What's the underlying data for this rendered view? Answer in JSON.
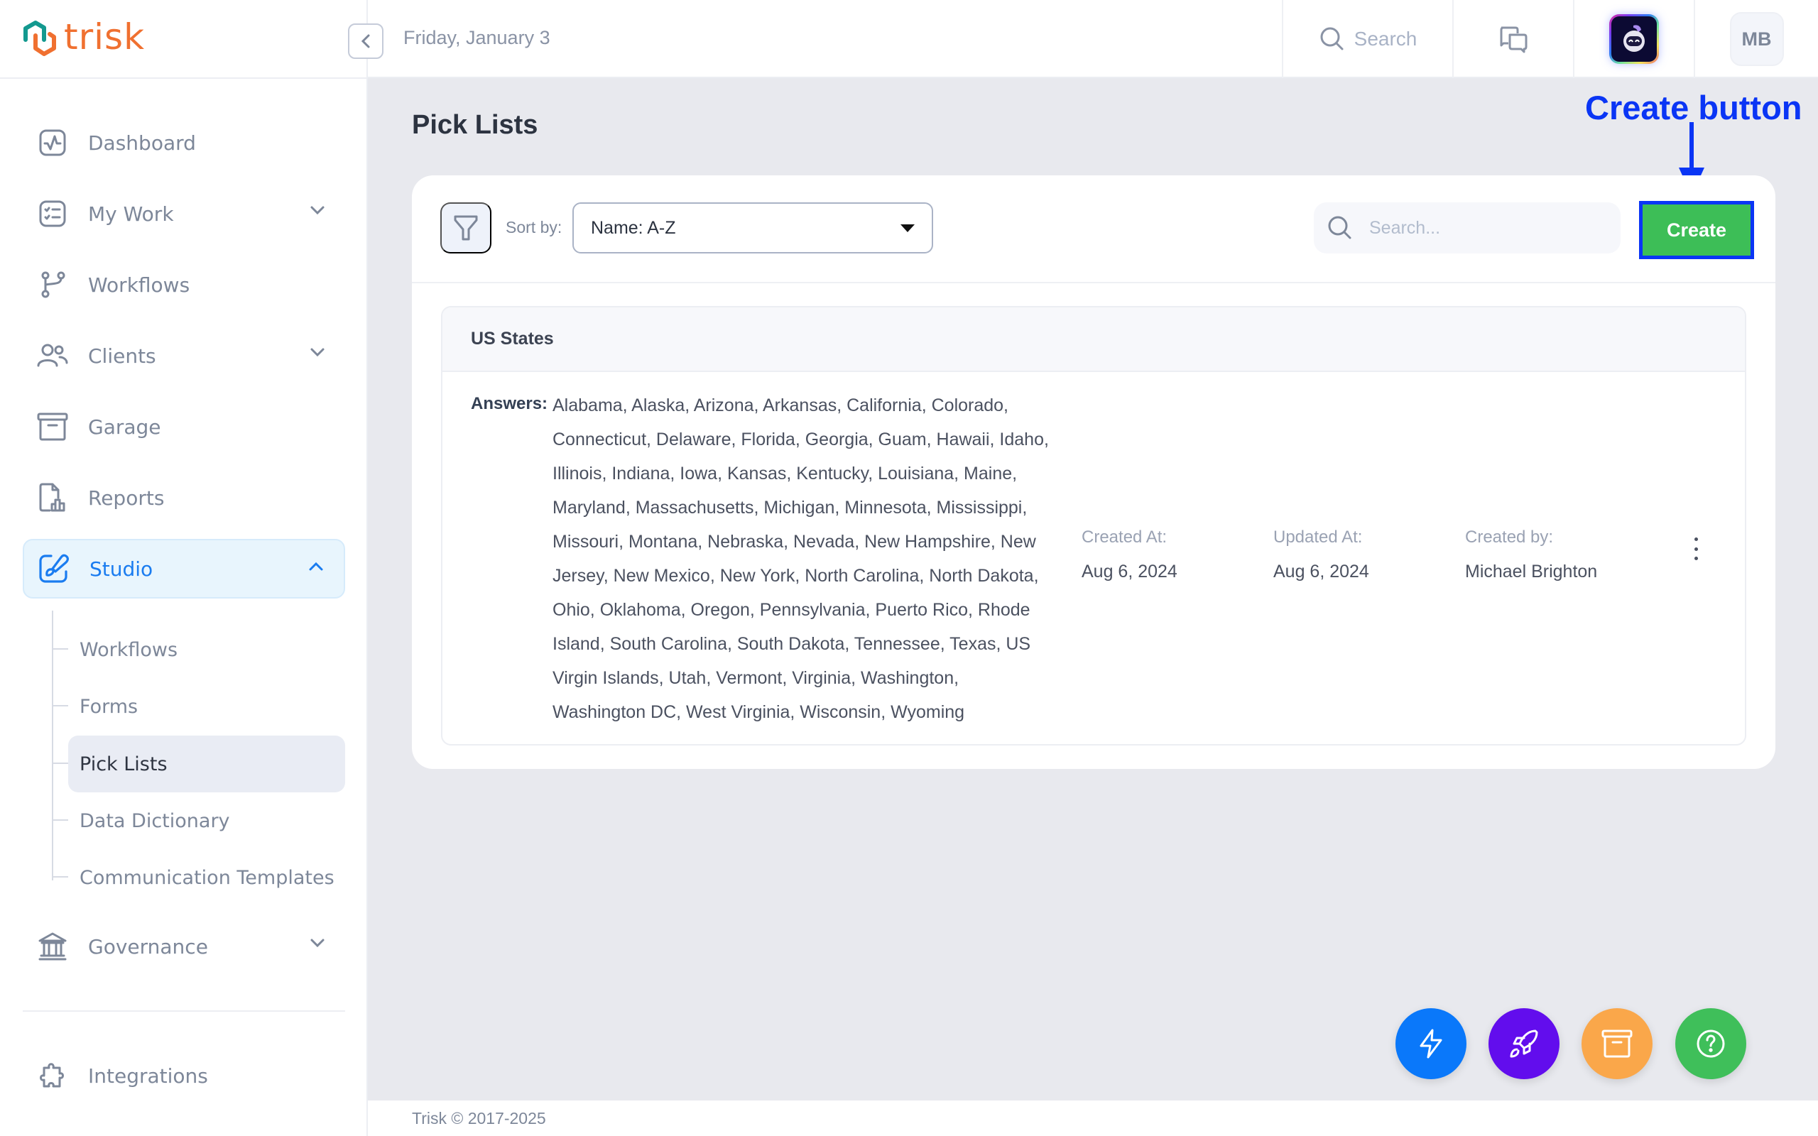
{
  "app": {
    "brand": "trisk",
    "brand_colors": {
      "orange": "#f07030",
      "teal": "#13998f"
    }
  },
  "header": {
    "date": "Friday, January 3",
    "search_label": "Search",
    "user_initials": "MB"
  },
  "sidebar": {
    "items": [
      {
        "label": "Dashboard",
        "icon": "activity-icon",
        "has_chevron": false
      },
      {
        "label": "My Work",
        "icon": "checklist-icon",
        "has_chevron": true
      },
      {
        "label": "Workflows",
        "icon": "git-branch-icon",
        "has_chevron": false
      },
      {
        "label": "Clients",
        "icon": "users-icon",
        "has_chevron": true
      },
      {
        "label": "Garage",
        "icon": "archive-icon",
        "has_chevron": false
      },
      {
        "label": "Reports",
        "icon": "report-chart-icon",
        "has_chevron": false
      },
      {
        "label": "Studio",
        "icon": "brush-icon",
        "has_chevron": true,
        "expanded": true,
        "active": true
      },
      {
        "label": "Governance",
        "icon": "bank-icon",
        "has_chevron": true
      },
      {
        "label": "Integrations",
        "icon": "puzzle-icon",
        "has_chevron": false
      }
    ],
    "studio_subitems": [
      {
        "label": "Workflows"
      },
      {
        "label": "Forms"
      },
      {
        "label": "Pick Lists",
        "active": true
      },
      {
        "label": "Data Dictionary"
      },
      {
        "label": "Communication Templates"
      }
    ]
  },
  "main": {
    "page_title": "Pick Lists",
    "annotation": "Create button",
    "toolbar": {
      "sort_label": "Sort by:",
      "sort_value": "Name: A-Z",
      "search_placeholder": "Search...",
      "create_label": "Create",
      "create_color": "#3dbe57"
    },
    "pick_lists": [
      {
        "title": "US States",
        "answers_label": "Answers:",
        "answers": "Alabama, Alaska, Arizona, Arkansas, California, Colorado, Connecticut, Delaware, Florida, Georgia, Guam, Hawaii, Idaho, Illinois, Indiana, Iowa, Kansas, Kentucky, Louisiana, Maine, Maryland, Massachusetts, Michigan, Minnesota, Mississippi, Missouri, Montana, Nebraska, Nevada, New Hampshire, New Jersey, New Mexico, New York, North Carolina, North Dakota, Ohio, Oklahoma, Oregon, Pennsylvania, Puerto Rico, Rhode Island, South Carolina, South Dakota, Tennessee, Texas, US Virgin Islands, Utah, Vermont, Virginia, Washington, Washington DC, West Virginia, Wisconsin, Wyoming",
        "created_at_label": "Created At:",
        "created_at": "Aug 6, 2024",
        "updated_at_label": "Updated At:",
        "updated_at": "Aug 6, 2024",
        "created_by_label": "Created by:",
        "created_by": "Michael Brighton"
      }
    ]
  },
  "fabs": [
    {
      "name": "lightning-icon",
      "color": "#0a78fa"
    },
    {
      "name": "rocket-icon",
      "color": "#620ded"
    },
    {
      "name": "archive-icon",
      "color": "#faa74a"
    },
    {
      "name": "help-icon",
      "color": "#3fbf5a"
    }
  ],
  "footer": {
    "text": "Trisk © 2017-2025"
  }
}
